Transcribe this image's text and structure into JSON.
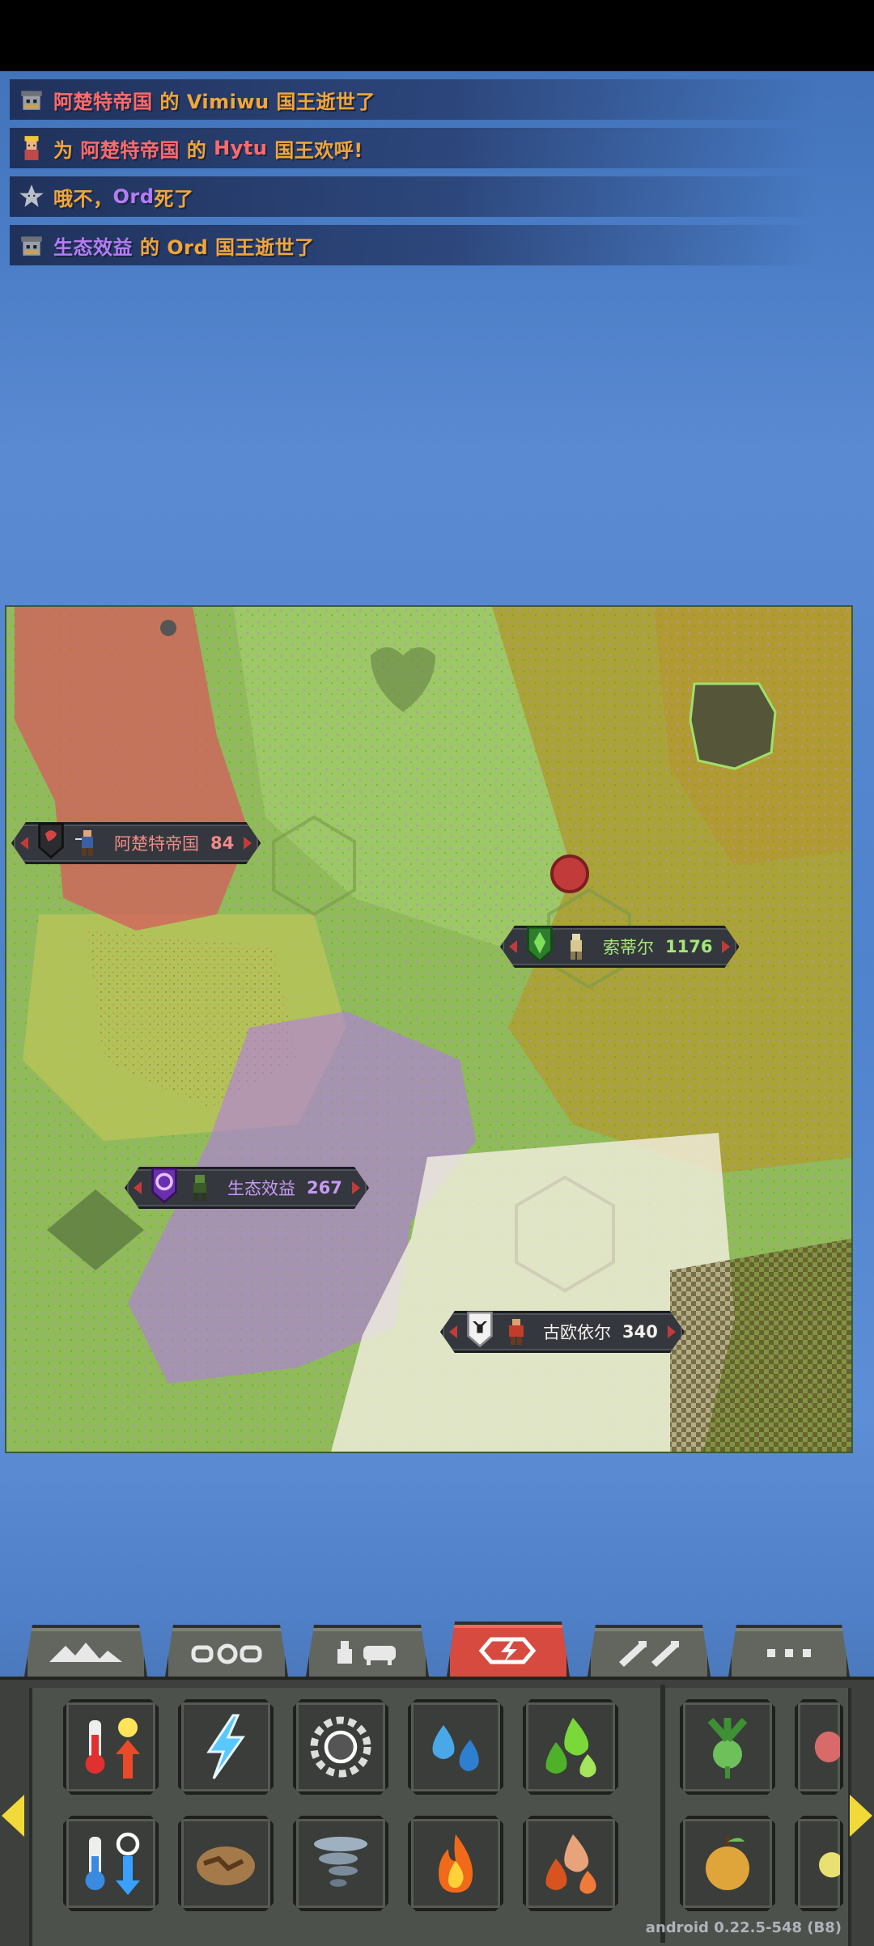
{
  "notifications": [
    {
      "icon": "skull-crown-icon",
      "parts": [
        {
          "text": "阿楚特帝国",
          "color": "red"
        },
        {
          "text": " 的 Vimiwu 国王逝世了",
          "color": "orange"
        }
      ]
    },
    {
      "icon": "king-icon",
      "parts": [
        {
          "text": "为 ",
          "color": "orange"
        },
        {
          "text": "阿楚特帝国",
          "color": "red"
        },
        {
          "text": " 的 ",
          "color": "orange"
        },
        {
          "text": "Hytu",
          "color": "red"
        },
        {
          "text": " 国王欢呼!",
          "color": "orange"
        }
      ]
    },
    {
      "icon": "skull-star-icon",
      "parts": [
        {
          "text": "哦不，",
          "color": "orange"
        },
        {
          "text": "Ord",
          "color": "purple"
        },
        {
          "text": "死了",
          "color": "orange"
        }
      ]
    },
    {
      "icon": "skull-crown-icon",
      "parts": [
        {
          "text": "生态效益",
          "color": "purple"
        },
        {
          "text": " 的 Ord 国王逝世了",
          "color": "orange"
        }
      ]
    }
  ],
  "kingdoms": [
    {
      "name": "阿楚特帝国",
      "population": "84",
      "color": "#d65c5c",
      "emblem": "red-wolf-emblem-icon"
    },
    {
      "name": "索蒂尔",
      "population": "1176",
      "color": "#9be06a",
      "emblem": "green-leaf-emblem-icon"
    },
    {
      "name": "生态效益",
      "population": "267",
      "color": "#b27ae8",
      "emblem": "purple-swirl-emblem-icon"
    },
    {
      "name": "古欧依尔",
      "population": "340",
      "color": "#f4f0ea",
      "emblem": "white-ox-emblem-icon"
    }
  ],
  "tabs": [
    {
      "name": "terrain-tab-mountains-icon",
      "active": false
    },
    {
      "name": "tab-kingdoms-icon",
      "active": false
    },
    {
      "name": "tab-creatures-icon",
      "active": false
    },
    {
      "name": "tab-powers-icon",
      "active": true
    },
    {
      "name": "tab-tools-icon",
      "active": false
    },
    {
      "name": "tab-more-icon",
      "active": false
    }
  ],
  "powers_row1": [
    "heat-up-icon",
    "lightning-icon",
    "rain-cloud-icon",
    "water-drops-icon",
    "acid-drops-icon",
    "seed-plant-icon",
    "meat-drop-icon"
  ],
  "powers_row2": [
    "cool-down-icon",
    "earthquake-icon",
    "tornado-icon",
    "fire-icon",
    "lava-drops-icon",
    "fruit-bush-icon",
    "fruit-icon"
  ],
  "colors": {
    "accent_tab": "#d64a40",
    "text_orange": "#f0a63a",
    "text_red": "#ff6b6b",
    "text_purple": "#b47cf5"
  },
  "version": "android 0.22.5-548 (B8)"
}
